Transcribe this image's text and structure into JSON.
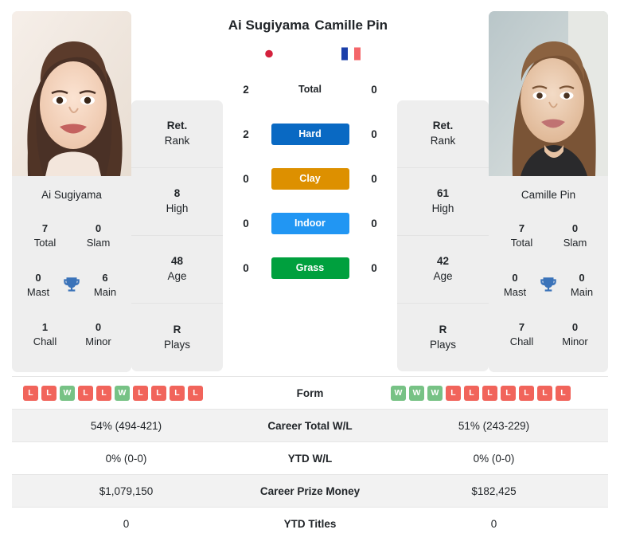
{
  "players": {
    "left": {
      "name": "Ai Sugiyama",
      "photo_caption": "Ai Sugiyama",
      "flag": "japan-flag",
      "titles": {
        "total_value": "7",
        "total_label": "Total",
        "slam_value": "0",
        "slam_label": "Slam",
        "mast_value": "0",
        "mast_label": "Mast",
        "main_value": "6",
        "main_label": "Main",
        "chall_value": "1",
        "chall_label": "Chall",
        "minor_value": "0",
        "minor_label": "Minor"
      },
      "stats": [
        {
          "value": "Ret.",
          "label": "Rank"
        },
        {
          "value": "8",
          "label": "High"
        },
        {
          "value": "48",
          "label": "Age"
        },
        {
          "value": "R",
          "label": "Plays"
        }
      ],
      "form": [
        "L",
        "L",
        "W",
        "L",
        "L",
        "W",
        "L",
        "L",
        "L",
        "L"
      ],
      "career_total_wl": "54% (494-421)",
      "ytd_wl": "0% (0-0)",
      "career_prize_money": "$1,079,150",
      "ytd_titles": "0"
    },
    "right": {
      "name": "Camille Pin",
      "photo_caption": "Camille Pin",
      "flag": "france-flag",
      "titles": {
        "total_value": "7",
        "total_label": "Total",
        "slam_value": "0",
        "slam_label": "Slam",
        "mast_value": "0",
        "mast_label": "Mast",
        "main_value": "0",
        "main_label": "Main",
        "chall_value": "7",
        "chall_label": "Chall",
        "minor_value": "0",
        "minor_label": "Minor"
      },
      "stats": [
        {
          "value": "Ret.",
          "label": "Rank"
        },
        {
          "value": "61",
          "label": "High"
        },
        {
          "value": "42",
          "label": "Age"
        },
        {
          "value": "R",
          "label": "Plays"
        }
      ],
      "form": [
        "W",
        "W",
        "W",
        "L",
        "L",
        "L",
        "L",
        "L",
        "L",
        "L"
      ],
      "career_total_wl": "51% (243-229)",
      "ytd_wl": "0% (0-0)",
      "career_prize_money": "$182,425",
      "ytd_titles": "0"
    }
  },
  "head_to_head": [
    {
      "label": "Total",
      "left": "2",
      "right": "0",
      "color": null,
      "badge": false
    },
    {
      "label": "Hard",
      "left": "2",
      "right": "0",
      "color": "#0969c3",
      "badge": true
    },
    {
      "label": "Clay",
      "left": "0",
      "right": "0",
      "color": "#dd9000",
      "badge": true
    },
    {
      "label": "Indoor",
      "left": "0",
      "right": "0",
      "color": "#2196f3",
      "badge": true
    },
    {
      "label": "Grass",
      "left": "0",
      "right": "0",
      "color": "#00a03e",
      "badge": true
    }
  ],
  "table": {
    "rows": [
      {
        "label": "Form",
        "key": "form"
      },
      {
        "label": "Career Total W/L",
        "key": "career_total_wl"
      },
      {
        "label": "YTD W/L",
        "key": "ytd_wl"
      },
      {
        "label": "Career Prize Money",
        "key": "career_prize_money"
      },
      {
        "label": "YTD Titles",
        "key": "ytd_titles"
      }
    ]
  },
  "colors": {
    "win": "#77c285",
    "loss": "#f1645b",
    "trophy": "#3b73b9",
    "card_bg": "#eeeeee",
    "row_shade": "#f2f2f2"
  }
}
